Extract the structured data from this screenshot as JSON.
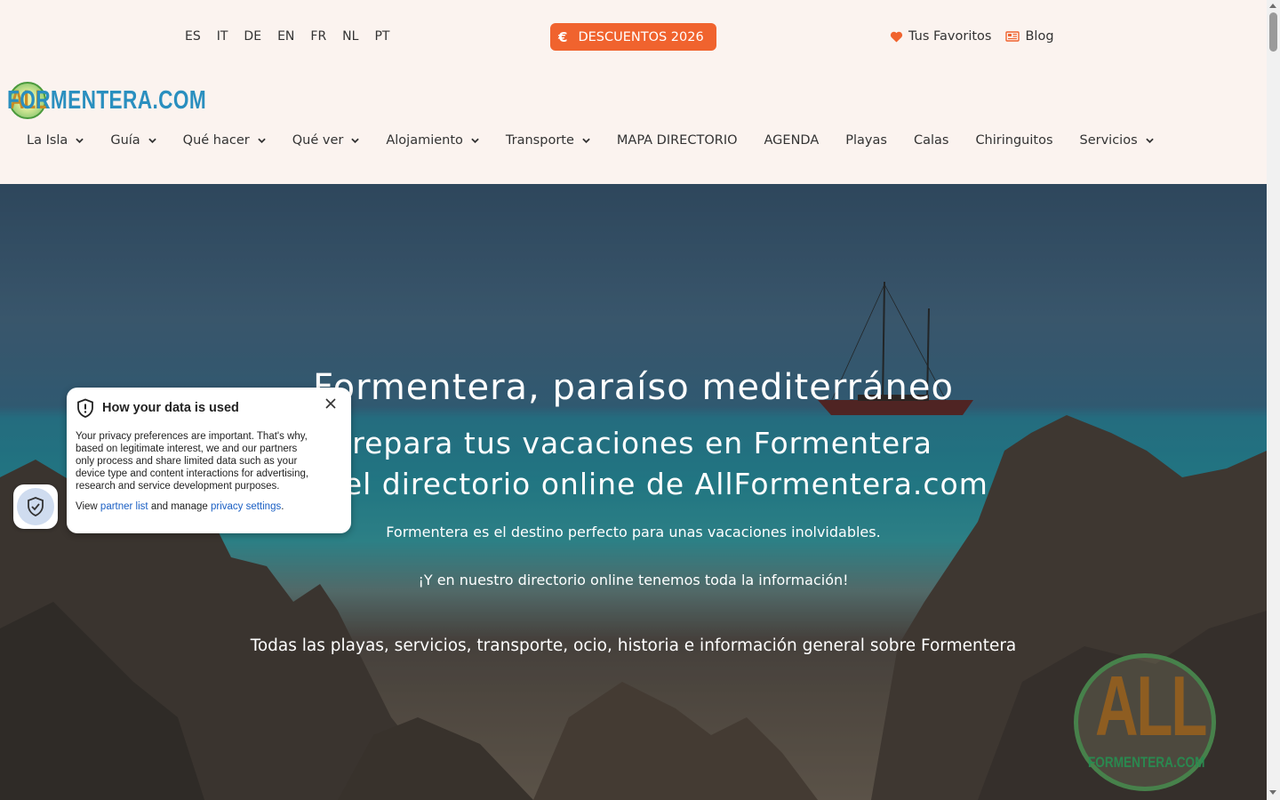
{
  "languages": [
    "ES",
    "IT",
    "DE",
    "EN",
    "FR",
    "NL",
    "PT"
  ],
  "promo": {
    "symbol": "€",
    "label": "DESCUENTOS 2026",
    "color": "#f0632e"
  },
  "utils": {
    "favorites": "Tus Favoritos",
    "blog": "Blog"
  },
  "logo": {
    "mark": "ALL",
    "text": "FORMENTERA.COM"
  },
  "nav": [
    {
      "label": "La Isla",
      "dropdown": true
    },
    {
      "label": "Guía",
      "dropdown": true
    },
    {
      "label": "Qué hacer",
      "dropdown": true
    },
    {
      "label": "Qué ver",
      "dropdown": true
    },
    {
      "label": "Alojamiento",
      "dropdown": true
    },
    {
      "label": "Transporte",
      "dropdown": true
    },
    {
      "label": "MAPA DIRECTORIO",
      "dropdown": false
    },
    {
      "label": "AGENDA",
      "dropdown": false
    },
    {
      "label": "Playas",
      "dropdown": false
    },
    {
      "label": "Calas",
      "dropdown": false
    },
    {
      "label": "Chiringuitos",
      "dropdown": false
    },
    {
      "label": "Servicios",
      "dropdown": true
    }
  ],
  "hero": {
    "title": "Formentera, paraíso mediterráneo",
    "subtitle_line1": "Prepara tus vacaciones en Formentera",
    "subtitle_line2": "con el directorio online de AllFormentera.com",
    "paragraph1": "Formentera es el destino perfecto para unas vacaciones inolvidables.",
    "paragraph2": "¡Y en nuestro directorio online tenemos toda la información!",
    "paragraph3": "Todas las playas, servicios, transporte, ocio, historia e información general sobre Formentera"
  },
  "watermark": {
    "main": "ALL",
    "sub": "FORMENTERA.COM"
  },
  "privacy": {
    "title": "How your data is used",
    "body": "Your privacy preferences are important. That's why, based on legitimate interest, we and our partners only process and share limited data such as your device type and content interactions for advertising, research and service development purposes.",
    "foot_prefix": "View",
    "partner_link": "partner list",
    "foot_middle": "and manage",
    "settings_link": "privacy settings",
    "foot_suffix": "."
  }
}
